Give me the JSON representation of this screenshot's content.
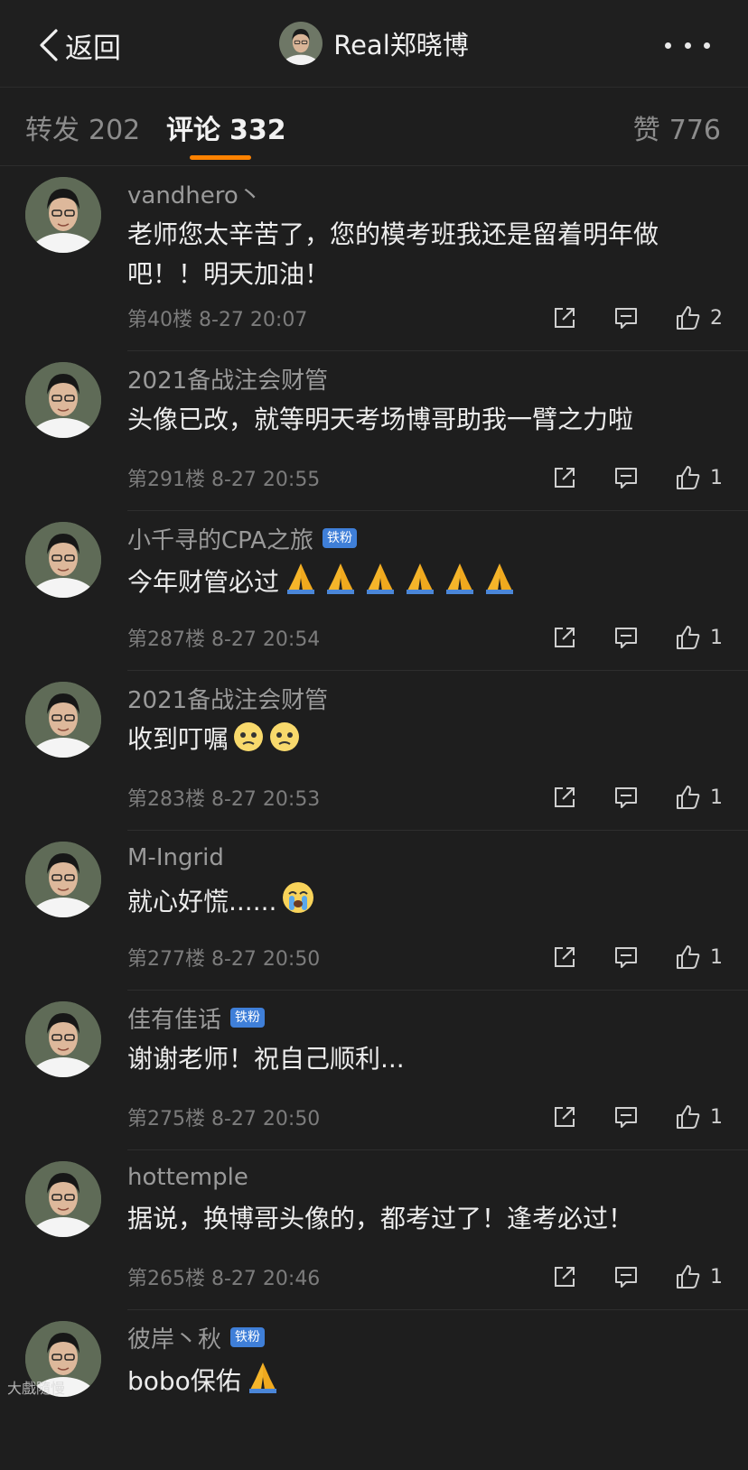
{
  "header": {
    "back_label": "返回",
    "title": "Real郑晓博"
  },
  "tabs": {
    "repost_label": "转发",
    "repost_count": "202",
    "comment_label": "评论",
    "comment_count": "332",
    "like_label": "赞",
    "like_count": "776"
  },
  "comments": [
    {
      "user": "vandhero丶",
      "badge": "",
      "text": "老师您太辛苦了，您的模考班我还是留着明年做吧！！明天加油！",
      "floor": "第40楼 8-27 20:07",
      "likes": "2",
      "emoji": ""
    },
    {
      "user": "2021备战注会财管",
      "badge": "",
      "text": "头像已改，就等明天考场博哥助我一臂之力啦",
      "floor": "第291楼 8-27 20:55",
      "likes": "1",
      "emoji": ""
    },
    {
      "user": "小千寻的CPA之旅",
      "badge": "铁粉",
      "text": "今年财管必过",
      "floor": "第287楼 8-27 20:54",
      "likes": "1",
      "emoji": "pray-x6"
    },
    {
      "user": "2021备战注会财管",
      "badge": "",
      "text": "收到叮嘱",
      "floor": "第283楼 8-27 20:53",
      "likes": "1",
      "emoji": "sad-x2"
    },
    {
      "user": "M-Ingrid",
      "badge": "",
      "text": "就心好慌......",
      "floor": "第277楼 8-27 20:50",
      "likes": "1",
      "emoji": "cry"
    },
    {
      "user": "佳有佳话",
      "badge": "铁粉",
      "text": "谢谢老师！祝自己顺利...",
      "floor": "第275楼 8-27 20:50",
      "likes": "1",
      "emoji": ""
    },
    {
      "user": "hottemple",
      "badge": "",
      "text": "据说，换博哥头像的，都考过了！逢考必过！",
      "floor": "第265楼 8-27 20:46",
      "likes": "1",
      "emoji": ""
    },
    {
      "user": "彼岸丶秋",
      "badge": "铁粉",
      "text": "bobo保佑",
      "floor": "",
      "likes": "",
      "emoji": "pray"
    }
  ],
  "watermark": "大戲隨慢"
}
